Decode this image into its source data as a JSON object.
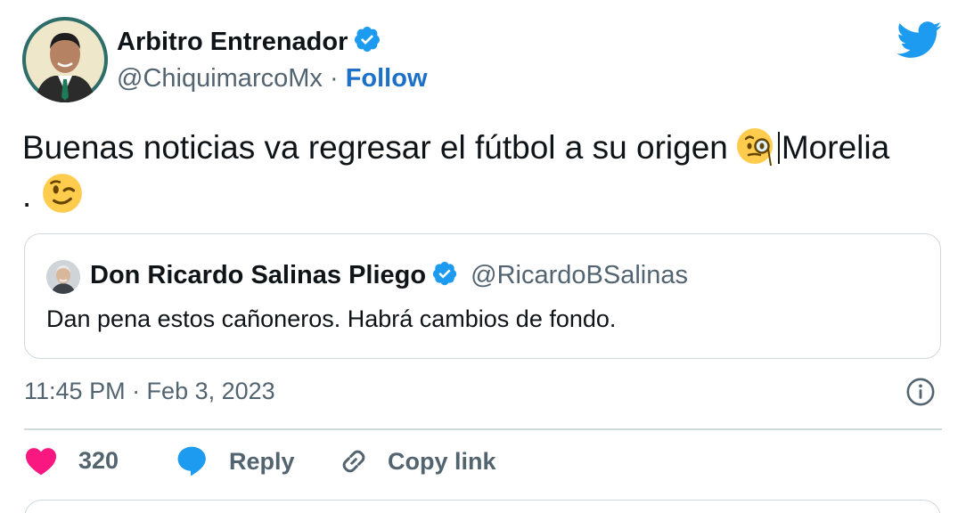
{
  "author": {
    "name": "Arbitro Entrenador",
    "handle": "@ChiquimarcoMx",
    "separator": "·",
    "follow_label": "Follow",
    "verified": true
  },
  "tweet": {
    "text_part1": "Buenas noticias va regresar el fútbol a su origen",
    "emoji_1": "face-with-monocle",
    "text_part2": "Morelia",
    "text_part3": ".",
    "emoji_2": "winking-face"
  },
  "quote": {
    "name": "Don Ricardo Salinas Pliego",
    "handle": "@RicardoBSalinas",
    "verified": true,
    "text": "Dan pena estos cañoneros. Habrá cambios de fondo."
  },
  "meta": {
    "timestamp": "11:45 PM · Feb 3, 2023"
  },
  "actions": {
    "like_count": "320",
    "reply_label": "Reply",
    "copy_label": "Copy link"
  },
  "colors": {
    "brand_blue": "#1d9bf0",
    "follow_blue": "#1d70c7",
    "like_pink": "#f91880",
    "muted": "#536471",
    "border": "#cfd9de"
  }
}
